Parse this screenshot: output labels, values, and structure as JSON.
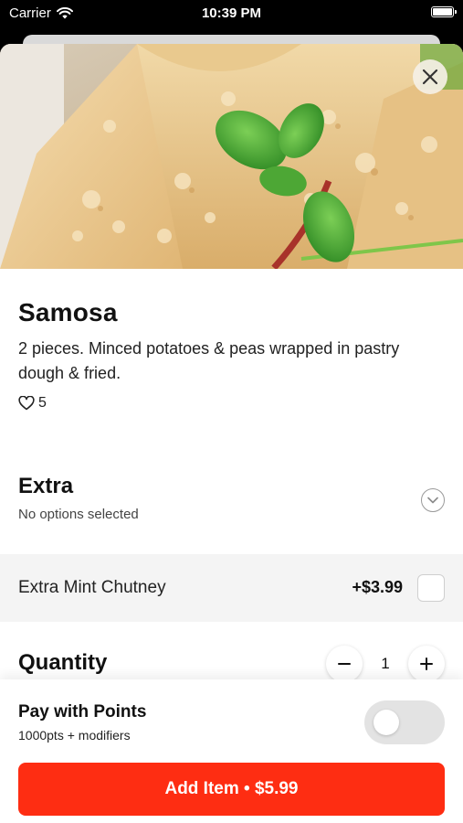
{
  "status_bar": {
    "carrier": "Carrier",
    "time": "10:39 PM",
    "battery_level": 1.0,
    "icons": [
      "wifi-icon",
      "battery-icon"
    ]
  },
  "hero": {
    "image": "samosa-photo",
    "close_icon": "close-icon"
  },
  "item": {
    "name": "Samosa",
    "description": "2 pieces. Minced potatoes & peas wrapped in pastry dough & fried.",
    "likes": "5",
    "like_icon": "heart-icon"
  },
  "extra": {
    "title": "Extra",
    "subtitle": "No options selected",
    "chevron_icon": "chevron-down-icon",
    "options": [
      {
        "label": "Extra Mint Chutney",
        "price": "+$3.99",
        "checked": false
      }
    ]
  },
  "quantity": {
    "title": "Quantity",
    "value": "1",
    "decrement_icon": "minus-icon",
    "increment_icon": "plus-icon"
  },
  "points": {
    "title": "Pay with Points",
    "subtitle": "1000pts + modifiers",
    "enabled": false
  },
  "cta": {
    "label": "Add Item • $5.99"
  },
  "colors": {
    "accent": "#fe2d12",
    "option_bg": "#f4f4f4",
    "toggle_off": "#e3e3e3"
  }
}
